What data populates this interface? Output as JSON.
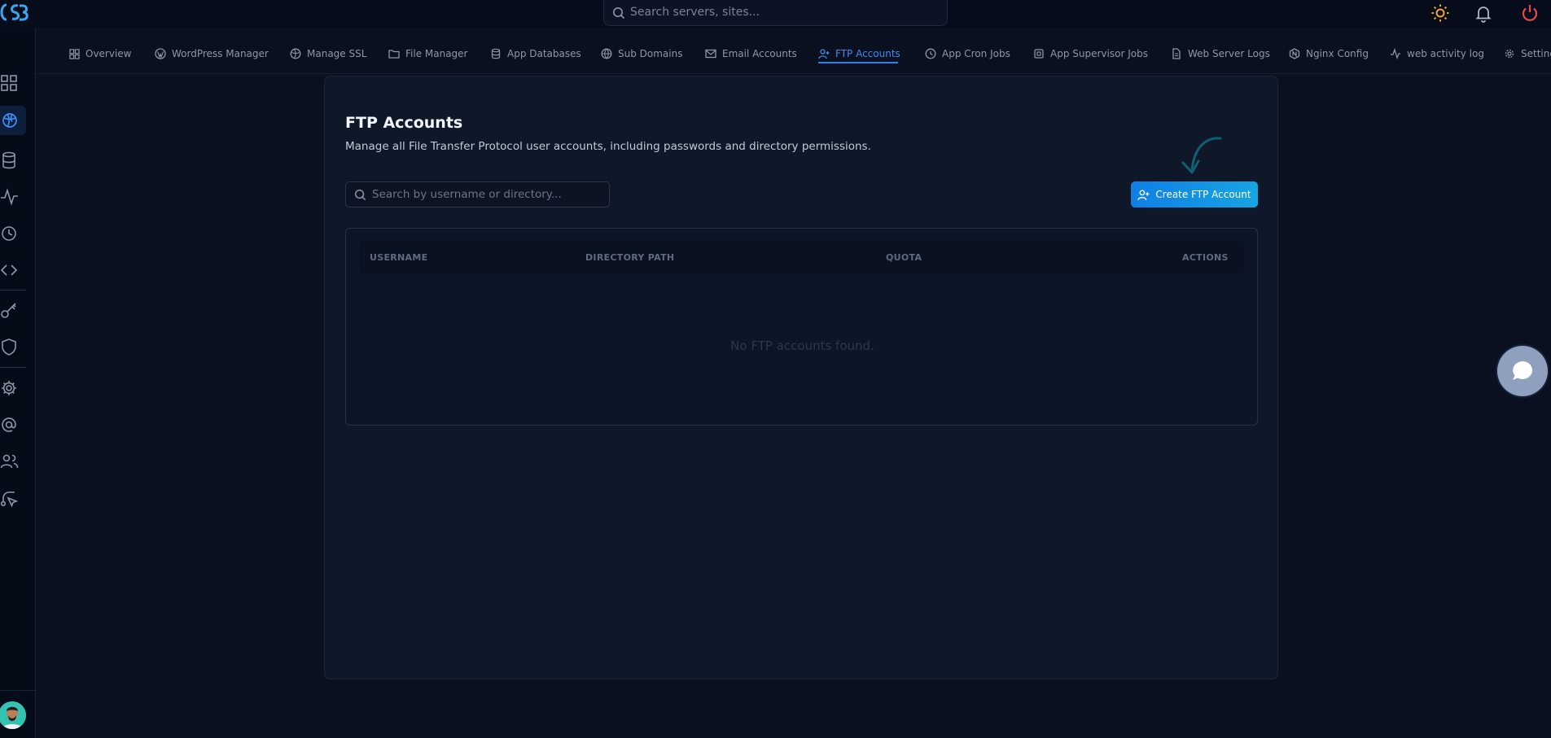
{
  "search": {
    "placeholder": "Search servers, sites..."
  },
  "tabs": [
    {
      "label": "Overview",
      "icon": "grid-icon",
      "active": false
    },
    {
      "label": "WordPress Manager",
      "icon": "wordpress-icon",
      "active": false
    },
    {
      "label": "Manage SSL",
      "icon": "globe-lock-icon",
      "active": false
    },
    {
      "label": "File Manager",
      "icon": "folder-icon",
      "active": false
    },
    {
      "label": "App Databases",
      "icon": "database-icon",
      "active": false
    },
    {
      "label": "Sub Domains",
      "icon": "globe-icon",
      "active": false
    },
    {
      "label": "Email Accounts",
      "icon": "mail-icon",
      "active": false
    },
    {
      "label": "FTP Accounts",
      "icon": "user-plus-icon",
      "active": true
    },
    {
      "label": "App Cron Jobs",
      "icon": "clock-globe-icon",
      "active": false
    },
    {
      "label": "App Supervisor Jobs",
      "icon": "cpu-icon",
      "active": false
    },
    {
      "label": "Web Server Logs",
      "icon": "file-icon",
      "active": false
    },
    {
      "label": "Nginx Config",
      "icon": "hexagon-icon",
      "active": false
    },
    {
      "label": "web activity log",
      "icon": "activity-icon",
      "active": false
    },
    {
      "label": "Settings",
      "icon": "gear-icon",
      "active": false
    }
  ],
  "page": {
    "title": "FTP Accounts",
    "subtitle": "Manage all File Transfer Protocol user accounts, including passwords and directory permissions."
  },
  "filter": {
    "placeholder": "Search by username or directory..."
  },
  "create_button": {
    "label": "Create FTP Account"
  },
  "table": {
    "columns": [
      "USERNAME",
      "DIRECTORY PATH",
      "QUOTA",
      "ACTIONS"
    ],
    "empty_message": "No FTP accounts found."
  },
  "colors": {
    "accent": "#2f80ed",
    "power": "#e5484d",
    "sun": "#f5a524"
  }
}
